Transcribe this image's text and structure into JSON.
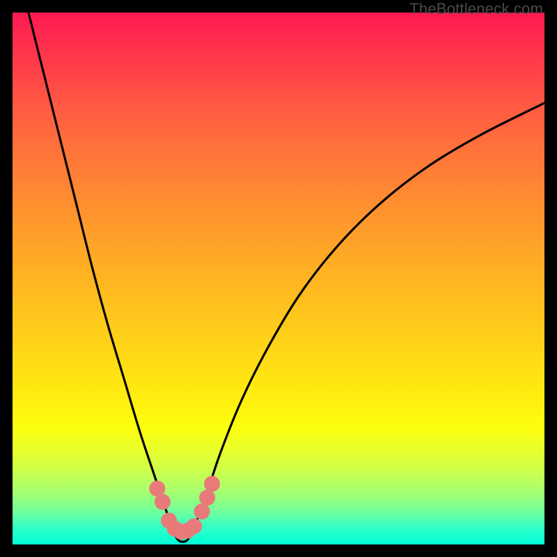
{
  "watermark": "TheBottleneck.com",
  "chart_data": {
    "type": "line",
    "title": "",
    "xlabel": "",
    "ylabel": "",
    "xlim": [
      0,
      100
    ],
    "ylim": [
      0,
      100
    ],
    "grid": false,
    "series": [
      {
        "name": "curve",
        "x": [
          3,
          6,
          9,
          12,
          15,
          18,
          21,
          24,
          27,
          29,
          30,
          31,
          32,
          33,
          34,
          36,
          39,
          43,
          48,
          54,
          61,
          69,
          78,
          88,
          100
        ],
        "y": [
          100,
          88,
          76,
          64,
          52,
          41,
          31,
          21,
          12,
          6,
          3,
          1,
          0.5,
          1,
          3,
          8,
          17,
          27,
          37,
          47,
          56,
          64,
          71,
          77,
          83
        ]
      }
    ],
    "markers": [
      {
        "x": 27.2,
        "y": 10.5
      },
      {
        "x": 28.2,
        "y": 8.0
      },
      {
        "x": 29.4,
        "y": 4.5
      },
      {
        "x": 30.5,
        "y": 3.0
      },
      {
        "x": 31.7,
        "y": 2.4
      },
      {
        "x": 32.9,
        "y": 2.6
      },
      {
        "x": 34.1,
        "y": 3.4
      },
      {
        "x": 35.6,
        "y": 6.2
      },
      {
        "x": 36.6,
        "y": 8.8
      },
      {
        "x": 37.5,
        "y": 11.4
      }
    ],
    "colors": {
      "curve": "#000000",
      "marker_fill": "#e97a7a",
      "marker_stroke": "#e97a7a"
    }
  }
}
